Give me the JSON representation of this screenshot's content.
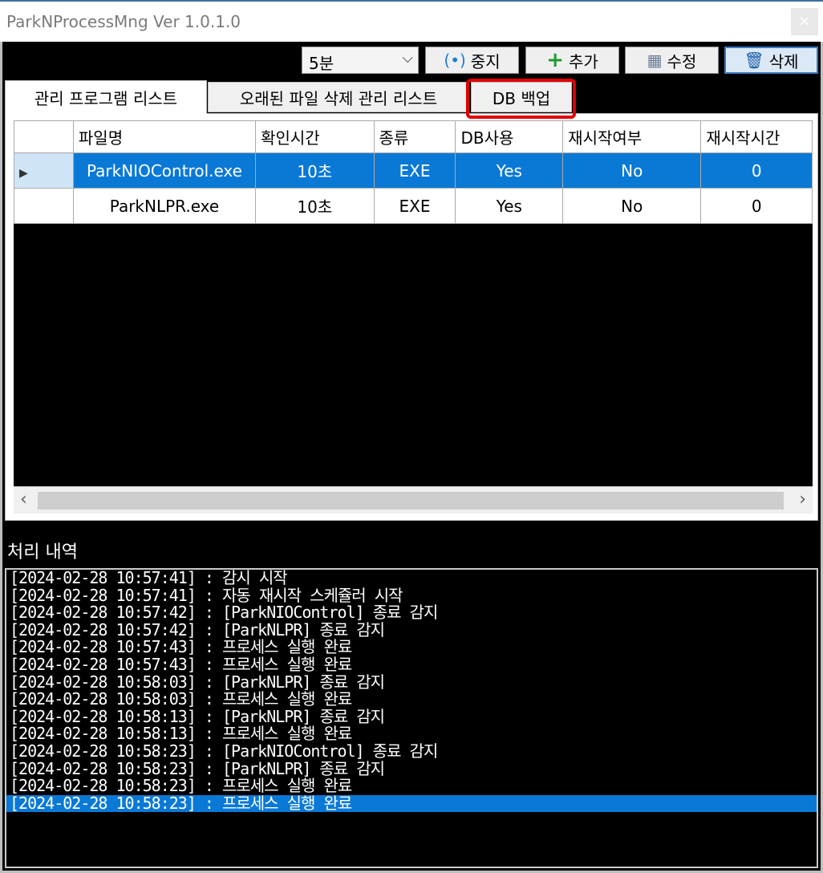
{
  "window": {
    "title": "ParkNProcessMng Ver 1.0.1.0",
    "close_label": "×"
  },
  "toolbar": {
    "interval": "5분",
    "stop_label": "중지",
    "add_label": "추가",
    "edit_label": "수정",
    "delete_label": "삭제"
  },
  "tabs": [
    {
      "label": "관리 프로그램 리스트"
    },
    {
      "label": "오래된 파일 삭제 관리 리스트"
    },
    {
      "label": "DB 백업"
    }
  ],
  "table": {
    "columns": [
      "파일명",
      "확인시간",
      "종류",
      "DB사용",
      "재시작여부",
      "재시작시간"
    ],
    "rows": [
      [
        "ParkNIOControl.exe",
        "10초",
        "EXE",
        "Yes",
        "No",
        "0"
      ],
      [
        "ParkNLPR.exe",
        "10초",
        "EXE",
        "Yes",
        "No",
        "0"
      ]
    ]
  },
  "log": {
    "label": "처리 내역",
    "lines": [
      "[2024-02-28 10:57:41] : 감시 시작",
      "[2024-02-28 10:57:41] : 자동 재시작 스케쥴러 시작",
      "[2024-02-28 10:57:42] : [ParkNIOControl] 종료 감지",
      "[2024-02-28 10:57:42] : [ParkNLPR] 종료 감지",
      "[2024-02-28 10:57:43] : 프로세스 실행 완료",
      "[2024-02-28 10:57:43] : 프로세스 실행 완료",
      "[2024-02-28 10:58:03] : [ParkNLPR] 종료 감지",
      "[2024-02-28 10:58:03] : 프로세스 실행 완료",
      "[2024-02-28 10:58:13] : [ParkNLPR] 종료 감지",
      "[2024-02-28 10:58:13] : 프로세스 실행 완료",
      "[2024-02-28 10:58:23] : [ParkNIOControl] 종료 감지",
      "[2024-02-28 10:58:23] : [ParkNLPR] 종료 감지",
      "[2024-02-28 10:58:23] : 프로세스 실행 완료",
      "[2024-02-28 10:58:23] : 프로세스 실행 완료"
    ]
  },
  "colors": {
    "selection": "#0a79d6",
    "highlight": "#e00000",
    "background": "#000000"
  }
}
